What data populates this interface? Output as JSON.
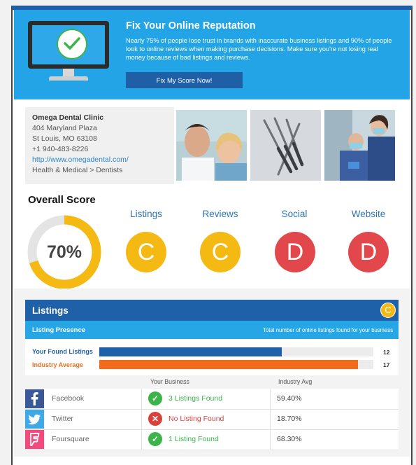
{
  "banner": {
    "title": "Fix Your Online Reputation",
    "body": "Nearly 75% of people lose trust in brands with inaccurate business listings and 90% of people look to online reviews when making purchase decisions. Make sure you're not losing real money because of bad listings and reviews.",
    "cta": "Fix My Score Now!"
  },
  "business": {
    "name": "Omega Dental Clinic",
    "address1": "404 Maryland Plaza",
    "address2": "St Louis, MO 63108",
    "phone": "+1 940-483-8226",
    "url": "http://www.omegadental.com/",
    "category": "Health & Medical > Dentists"
  },
  "scores": {
    "overall_label": "Overall Score",
    "overall_value": "70%",
    "overall_fraction": 0.7,
    "categories": [
      {
        "label": "Listings",
        "grade": "C"
      },
      {
        "label": "Reviews",
        "grade": "C"
      },
      {
        "label": "Social",
        "grade": "D"
      },
      {
        "label": "Website",
        "grade": "D"
      }
    ]
  },
  "listings": {
    "title": "Listings",
    "grade": "C",
    "presence_label": "Listing Presence",
    "presence_desc": "Total number of online listings found for your business",
    "your_label": "Your Found Listings",
    "your_value": "12",
    "industry_label": "Industry Average",
    "industry_value": "17",
    "col_business": "Your Business",
    "col_avg": "Industry Avg",
    "rows": [
      {
        "site": "Facebook",
        "status": "3 Listings Found",
        "found": true,
        "avg": "59.40%",
        "icon": "facebook-icon"
      },
      {
        "site": "Twitter",
        "status": "No Listing Found",
        "found": false,
        "avg": "18.70%",
        "icon": "twitter-icon"
      },
      {
        "site": "Foursquare",
        "status": "1 Listing Found",
        "found": true,
        "avg": "68.30%",
        "icon": "foursquare-icon"
      }
    ]
  },
  "colors": {
    "banner": "#22a4e6",
    "navy": "#1f61a8",
    "grade_c": "#f5b914",
    "grade_d": "#e2474b",
    "found": "#3bb54a",
    "not_found": "#d9413c",
    "your_bar": "#1f61a8",
    "industry_bar": "#f26b1d"
  }
}
